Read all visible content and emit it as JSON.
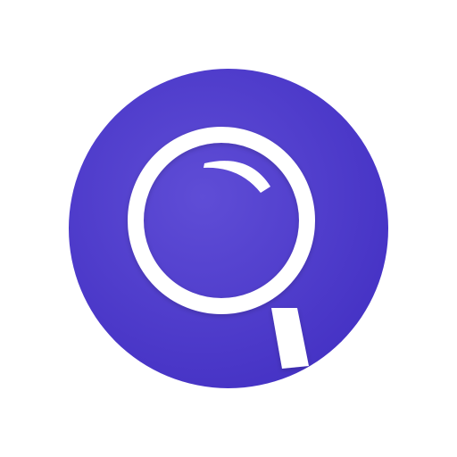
{
  "icon": {
    "name": "magnifying-glass-icon",
    "colors": {
      "background": "#ffffff",
      "circle_light": "#5f4dd6",
      "circle_dark": "#4330c3",
      "glyph": "#ffffff"
    }
  }
}
